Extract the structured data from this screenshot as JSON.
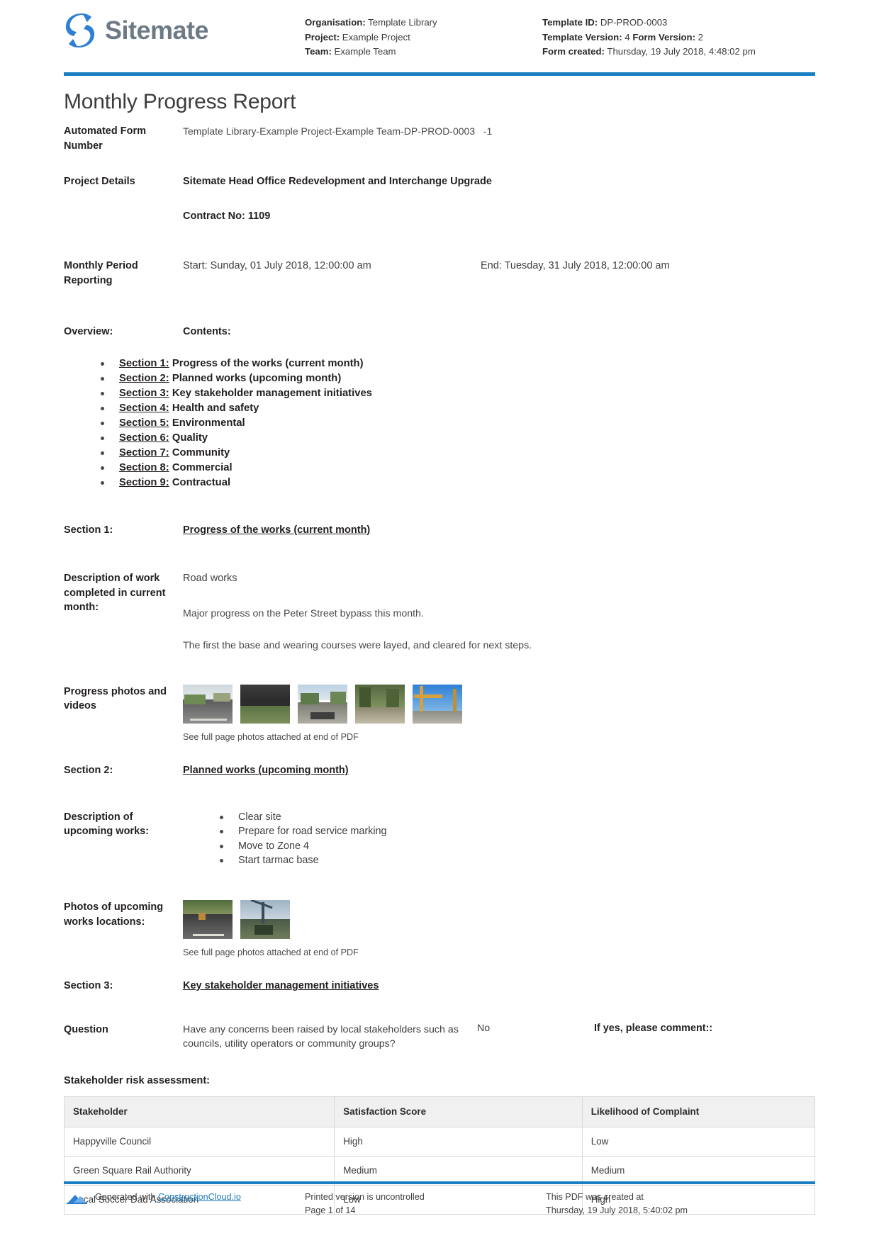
{
  "brand": {
    "name": "Sitemate",
    "logo_icon": "sitemate-logo-icon",
    "accent": "#1a7fc1"
  },
  "header": {
    "left": [
      {
        "label": "Organisation:",
        "value": "Template Library"
      },
      {
        "label": "Project:",
        "value": "Example Project"
      },
      {
        "label": "Team:",
        "value": "Example Team"
      }
    ],
    "right": {
      "template_id_label": "Template ID:",
      "template_id_value": "DP-PROD-0003",
      "template_version_label": "Template Version:",
      "template_version_value": "4",
      "form_version_label": "Form Version:",
      "form_version_value": "2",
      "form_created_label": "Form created:",
      "form_created_value": "Thursday, 19 July 2018, 4:48:02 pm"
    }
  },
  "document": {
    "title": "Monthly Progress Report",
    "form_number_label": "Automated Form Number",
    "form_number_value": "Template Library-Example Project-Example Team-DP-PROD-0003",
    "form_number_suffix": "-1",
    "project_details_label": "Project Details",
    "project_details_value": "Sitemate Head Office Redevelopment and Interchange Upgrade",
    "contract_no": "Contract No: 1109",
    "period_label": "Monthly Period Reporting",
    "period_start": "Start: Sunday, 01 July 2018, 12:00:00 am",
    "period_end": "End: Tuesday, 31 July 2018, 12:00:00 am",
    "overview_label": "Overview:",
    "contents_label": "Contents:"
  },
  "contents": [
    {
      "number": "Section 1:",
      "title": "Progress of the works (current month)"
    },
    {
      "number": "Section 2:",
      "title": "Planned works (upcoming month)"
    },
    {
      "number": "Section 3:",
      "title": "Key stakeholder management initiatives"
    },
    {
      "number": "Section 4:",
      "title": "Health and safety"
    },
    {
      "number": "Section 5:",
      "title": "Environmental"
    },
    {
      "number": "Section 6:",
      "title": "Quality"
    },
    {
      "number": "Section 7:",
      "title": "Community"
    },
    {
      "number": "Section 8:",
      "title": "Commercial"
    },
    {
      "number": "Section 9:",
      "title": "Contractual"
    }
  ],
  "section1": {
    "label": "Section 1:",
    "heading": "Progress of the works (current month)",
    "desc_label": "Description of work completed in current month:",
    "desc_heading": "Road works",
    "para1": "Major progress on the Peter Street bypass this month.",
    "para2": "The first the base and wearing courses were layed, and cleared for next steps.",
    "photos_label": "Progress photos and videos",
    "photos_caption": "See full page photos attached at end of PDF",
    "photo_count": 5
  },
  "section2": {
    "label": "Section 2:",
    "heading": "Planned works (upcoming month)",
    "desc_label": "Description of upcoming works:",
    "items": [
      "Clear site",
      "Prepare for road service marking",
      "Move to Zone 4",
      "Start tarmac base"
    ],
    "photos_label": "Photos of upcoming works locations:",
    "photos_caption": "See full page photos attached at end of PDF",
    "photo_count": 2
  },
  "section3": {
    "label": "Section 3:",
    "heading": "Key stakeholder management initiatives",
    "question_label": "Question",
    "question_text": "Have any concerns been raised by local stakeholders such as councils, utility operators or community groups?",
    "answer": "No",
    "if_yes_label": "If yes, please comment::",
    "table_title": "Stakeholder risk assessment:",
    "table": {
      "columns": [
        "Stakeholder",
        "Satisfaction Score",
        "Likelihood of Complaint"
      ],
      "rows": [
        [
          "Happyville Council",
          "High",
          "Low"
        ],
        [
          "Green Square Rail Authority",
          "Medium",
          "Medium"
        ],
        [
          "Local Soccer Dad Association",
          "Low",
          "High"
        ]
      ]
    }
  },
  "footer": {
    "generated_prefix": "Generated with ",
    "generated_link": "ConstructionCloud.io",
    "uncontrolled": "Printed version is uncontrolled",
    "page": "Page 1 of 14",
    "created_at_label": "This PDF was created at",
    "created_at_value": "Thursday, 19 July 2018, 5:40:02 pm",
    "icon": "constructioncloud-icon"
  }
}
